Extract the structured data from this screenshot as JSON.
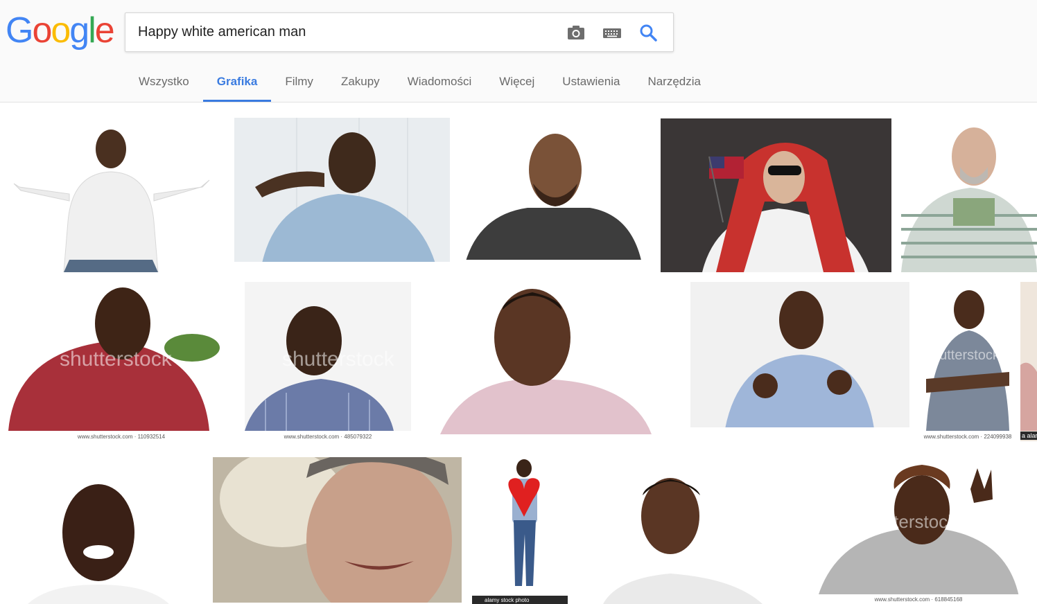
{
  "logo": {
    "letters": [
      "G",
      "o",
      "o",
      "g",
      "l",
      "e"
    ],
    "colors": [
      "#4285F4",
      "#EA4335",
      "#FBBC05",
      "#4285F4",
      "#34A853",
      "#EA4335"
    ]
  },
  "search": {
    "query": "Happy white american man",
    "camera_icon": "camera-icon",
    "keyboard_icon": "keyboard-icon",
    "search_icon": "search-icon"
  },
  "tabs": [
    {
      "label": "Wszystko",
      "active": false
    },
    {
      "label": "Grafika",
      "active": true
    },
    {
      "label": "Filmy",
      "active": false
    },
    {
      "label": "Zakupy",
      "active": false
    },
    {
      "label": "Wiadomości",
      "active": false
    },
    {
      "label": "Więcej",
      "active": false
    },
    {
      "label": "Ustawienia",
      "active": false
    },
    {
      "label": "Narzędzia",
      "active": false
    }
  ],
  "colors": {
    "accent": "#3a7be0",
    "tab_text": "#6a6a6a"
  },
  "results": {
    "r2_1": {
      "credit": "www.shutterstock.com · 110932514",
      "watermark": "shutterstock"
    },
    "r2_2": {
      "credit": "www.shutterstock.com · 485079322",
      "watermark": "shutterstock"
    },
    "r2_5": {
      "credit": "www.shutterstock.com · 224099938",
      "watermark": "shutterstock"
    },
    "r2_6": {
      "badge": "a alar"
    },
    "r3_3": {
      "credit": "alamy stock photo"
    },
    "r3_5": {
      "credit": "www.shutterstock.com · 618845168",
      "watermark": "shutterstock"
    }
  }
}
